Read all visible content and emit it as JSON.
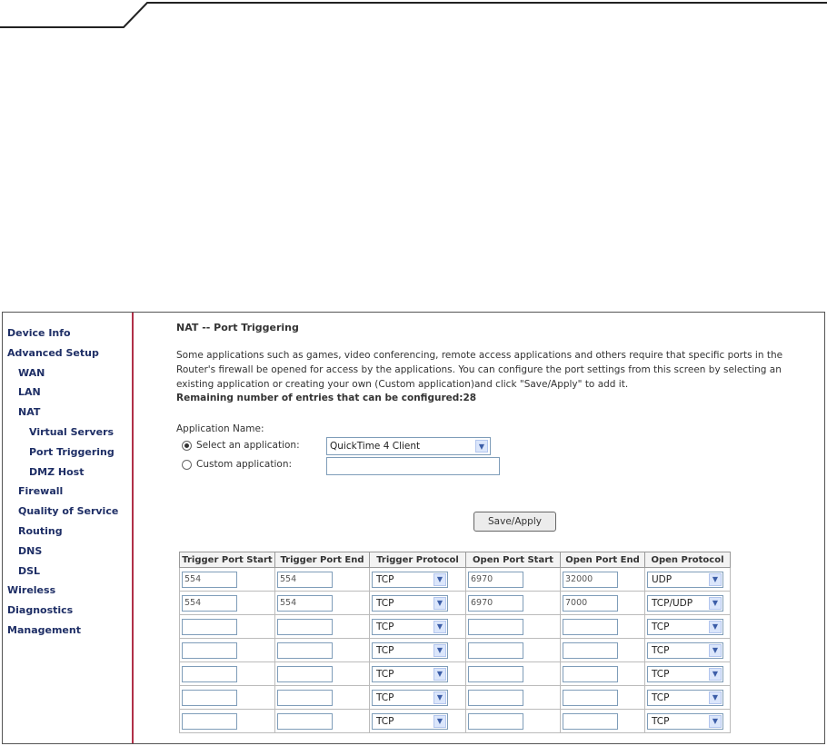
{
  "sidebar": {
    "items": [
      {
        "label": "Device Info",
        "level": 0
      },
      {
        "label": "Advanced Setup",
        "level": 0
      },
      {
        "label": "WAN",
        "level": 1
      },
      {
        "label": "LAN",
        "level": 1
      },
      {
        "label": "NAT",
        "level": 1
      },
      {
        "label": "Virtual Servers",
        "level": 2
      },
      {
        "label": "Port Triggering",
        "level": 2
      },
      {
        "label": "DMZ Host",
        "level": 2
      },
      {
        "label": "Firewall",
        "level": 1
      },
      {
        "label": "Quality of Service",
        "level": 1
      },
      {
        "label": "Routing",
        "level": 1
      },
      {
        "label": "DNS",
        "level": 1
      },
      {
        "label": "DSL",
        "level": 1
      },
      {
        "label": "Wireless",
        "level": 0
      },
      {
        "label": "Diagnostics",
        "level": 0
      },
      {
        "label": "Management",
        "level": 0
      }
    ]
  },
  "main": {
    "title": "NAT -- Port Triggering",
    "description_lines": [
      "Some applications such as games, video conferencing, remote access applications and others require that specific ports in the",
      "Router's firewall be opened for access by the applications. You can configure the port settings from this screen by selecting an",
      "existing application or creating your own (Custom application)and click \"Save/Apply\" to add it."
    ],
    "remaining": "Remaining number of entries that can be configured:28",
    "app_name_label": "Application Name:",
    "select_app_label": "Select an application:",
    "select_app_value": "QuickTime 4 Client",
    "custom_app_label": "Custom application:",
    "custom_app_value": "",
    "save_label": "Save/Apply"
  },
  "table": {
    "headers": [
      "Trigger Port Start",
      "Trigger Port End",
      "Trigger Protocol",
      "Open Port Start",
      "Open Port End",
      "Open Protocol"
    ],
    "rows": [
      [
        "554",
        "554",
        "TCP",
        "6970",
        "32000",
        "UDP"
      ],
      [
        "554",
        "554",
        "TCP",
        "6970",
        "7000",
        "TCP/UDP"
      ],
      [
        "",
        "",
        "TCP",
        "",
        "",
        "TCP"
      ],
      [
        "",
        "",
        "TCP",
        "",
        "",
        "TCP"
      ],
      [
        "",
        "",
        "TCP",
        "",
        "",
        "TCP"
      ],
      [
        "",
        "",
        "TCP",
        "",
        "",
        "TCP"
      ],
      [
        "",
        "",
        "TCP",
        "",
        "",
        "TCP"
      ]
    ]
  },
  "colors": {
    "sidebar_text": "#1f2f66",
    "sidebar_divider": "#b03048",
    "select_arrow": "#3c5ea8"
  }
}
